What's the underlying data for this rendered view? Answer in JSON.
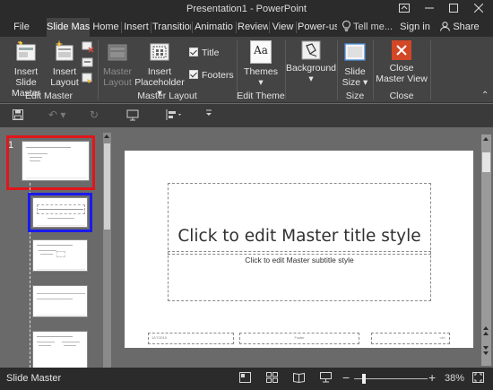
{
  "window": {
    "title": "Presentation1 - PowerPoint",
    "controls": [
      "help-lightbulb",
      "restore-ribbon",
      "minimize",
      "maximize",
      "close"
    ]
  },
  "tabs": [
    {
      "label": "File",
      "active": false
    },
    {
      "label": "Slide Mas",
      "active": true
    },
    {
      "label": "Home",
      "active": false
    },
    {
      "label": "Insert",
      "active": false
    },
    {
      "label": "Transitior",
      "active": false
    },
    {
      "label": "Animatio",
      "active": false
    },
    {
      "label": "Review",
      "active": false
    },
    {
      "label": "View",
      "active": false
    },
    {
      "label": "Power-us",
      "active": false
    }
  ],
  "tell_me": "Tell me...",
  "sign_in": "Sign in",
  "share": "Share",
  "ribbon": {
    "edit_master": {
      "group_label": "Edit Master",
      "insert_slide_master": [
        "Insert Slide",
        "Master"
      ],
      "insert_layout": [
        "Insert",
        "Layout"
      ]
    },
    "master_layout": {
      "group_label": "Master Layout",
      "master_layout_btn": [
        "Master",
        "Layout"
      ],
      "insert_placeholder": [
        "Insert",
        "Placeholder"
      ],
      "title_check": "Title",
      "footers_check": "Footers"
    },
    "edit_theme": {
      "group_label": "Edit Theme",
      "themes": "Themes",
      "themes_glyph": "Aa"
    },
    "background": {
      "group_label": "",
      "background": "Background"
    },
    "size": {
      "group_label": "Size",
      "slide_size": [
        "Slide",
        "Size"
      ]
    },
    "close": {
      "group_label": "Close",
      "close_master": [
        "Close",
        "Master View"
      ]
    }
  },
  "thumbnails": {
    "slide_number": "1",
    "master_title": "Click to edit Master title style"
  },
  "slide": {
    "title": "Click to edit Master title style",
    "subtitle": "Click to edit Master subtitle style",
    "date": "12/7/2015",
    "footer": "Footer",
    "slide_num": "<#>"
  },
  "status": {
    "view_name": "Slide Master",
    "zoom": "38%"
  },
  "colors": {
    "accent_tab": "#444444",
    "titlebar": "#2b2b2b",
    "selection_red": "#e0161b",
    "selection_blue": "#1a1aee",
    "close_master": "#d24726"
  }
}
